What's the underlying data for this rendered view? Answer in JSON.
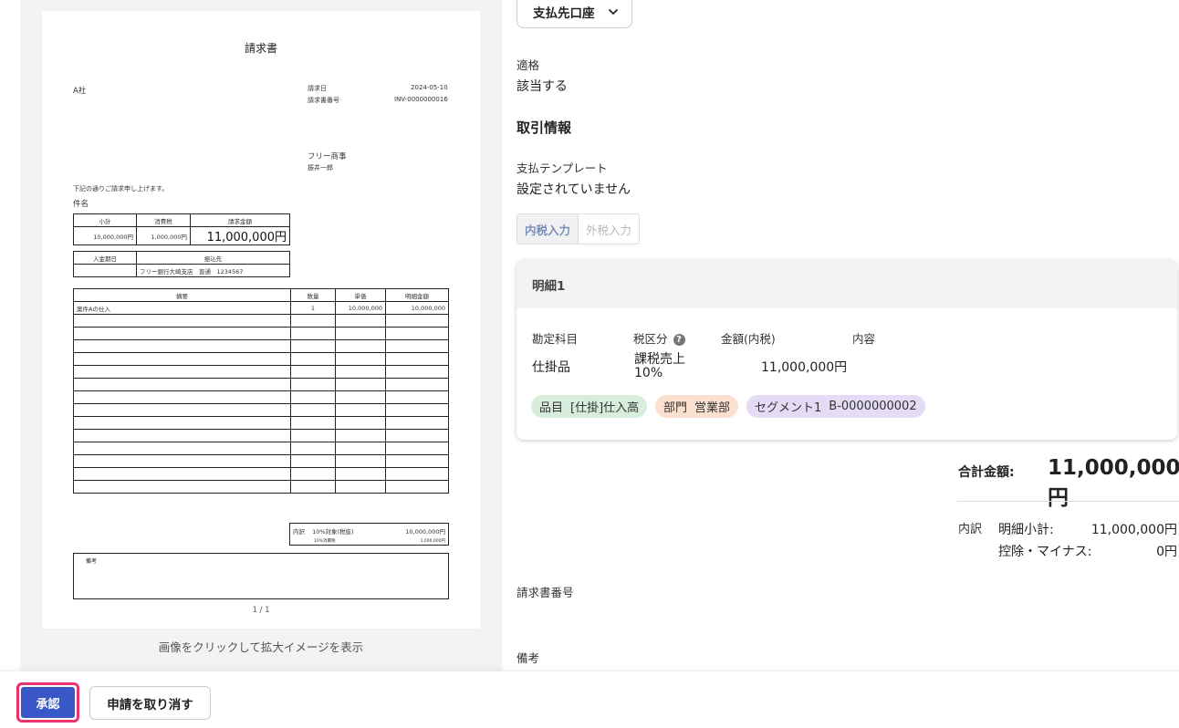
{
  "invoice_preview": {
    "title": "請求書",
    "client": "A社",
    "issue_date_label": "請求日",
    "issue_date": "2024-05-10",
    "invoice_no_label": "請求書番号",
    "invoice_no": "INV-0000000016",
    "issuer_company": "フリー商事",
    "issuer_person": "振井一郎",
    "intro": "下記の通りご請求申し上げます。",
    "subject_label": "件名",
    "summary_headers": [
      "小計",
      "消費税",
      "請求金額"
    ],
    "summary_values": [
      "10,000,000円",
      "1,000,000円",
      "11,000,000円"
    ],
    "payment_headers": [
      "入金期日",
      "振込先"
    ],
    "payment_values": [
      "",
      "フリー銀行大崎支店　普通　1234567"
    ],
    "lines_headers": [
      "摘要",
      "数量",
      "単価",
      "明細金額"
    ],
    "lines": [
      [
        "案件Aの仕入",
        "1",
        "10,000,000",
        "10,000,000"
      ]
    ],
    "tax_breakdown_label": "内訳",
    "tax_breakdown_target": "10%対象(税抜)",
    "tax_breakdown_amount": "10,000,000円",
    "tax_sub_label": "10%消費税",
    "tax_sub_amount": "1,000,000円",
    "remarks_label": "備考",
    "page": "1 / 1",
    "caption": "画像をクリックして拡大イメージを表示"
  },
  "account_button": {
    "label": "支払先口座"
  },
  "eligibility": {
    "label": "適格",
    "value": "該当する"
  },
  "transaction": {
    "section_title": "取引情報",
    "template_label": "支払テンプレート",
    "template_value": "設定されていません",
    "tax_mode_options": [
      "内税入力",
      "外税入力"
    ],
    "tax_mode_selected": "内税入力"
  },
  "detail_card": {
    "title": "明細1",
    "headers": {
      "account": "勘定科目",
      "tax": "税区分",
      "amount": "金額(内税)",
      "content": "内容"
    },
    "values": {
      "account": "仕掛品",
      "tax_line1": "課税売上",
      "tax_line2": "10%",
      "amount": "11,000,000円",
      "content": ""
    },
    "tags": [
      {
        "key": "品目",
        "value": "[仕掛]仕入高",
        "color": "#d7eedd"
      },
      {
        "key": "部門",
        "value": "営業部",
        "color": "#fbe0cf"
      },
      {
        "key": "セグメント1",
        "value": "B-0000000002",
        "color": "#e4dcf5"
      }
    ]
  },
  "totals": {
    "total_label": "合計金額:",
    "total_value": "11,000,000円",
    "breakdown_label": "内訳",
    "subtotal_label": "明細小計:",
    "subtotal_value": "11,000,000円",
    "deduction_label": "控除・マイナス:",
    "deduction_value": "0円"
  },
  "invoice_number_label": "請求書番号",
  "remarks_label": "備考",
  "footer": {
    "approve_label": "承認",
    "cancel_label": "申請を取り消す"
  },
  "colors": {
    "approve_bg": "#3a57c8",
    "approve_outline": "#e8336f"
  }
}
